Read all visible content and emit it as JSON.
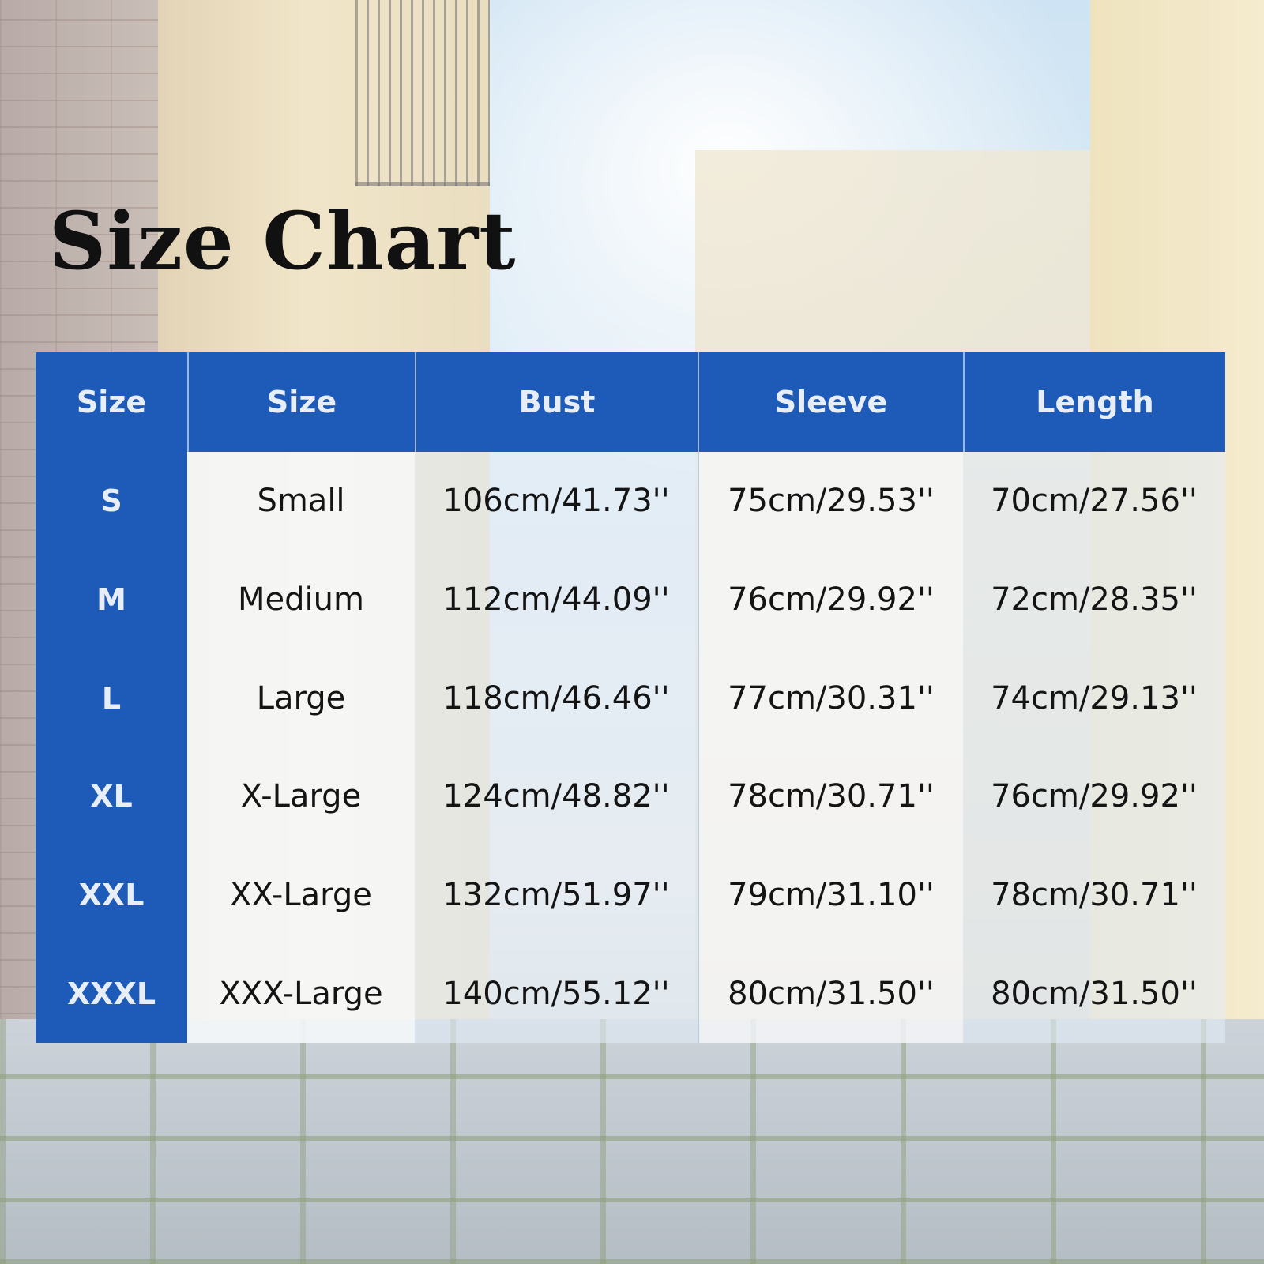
{
  "title": "Size Chart",
  "colors": {
    "header_blue": "#1e5ab7",
    "header_text": "#e8eef8",
    "title_text": "#111111"
  },
  "table": {
    "headers": [
      "Size",
      "Size",
      "Bust",
      "Sleeve",
      "Length"
    ],
    "rows": [
      {
        "code": "S",
        "name": "Small",
        "bust": "106cm/41.73''",
        "sleeve": "75cm/29.53''",
        "length": "70cm/27.56''"
      },
      {
        "code": "M",
        "name": "Medium",
        "bust": "112cm/44.09''",
        "sleeve": "76cm/29.92''",
        "length": "72cm/28.35''"
      },
      {
        "code": "L",
        "name": "Large",
        "bust": "118cm/46.46''",
        "sleeve": "77cm/30.31''",
        "length": "74cm/29.13''"
      },
      {
        "code": "XL",
        "name": "X-Large",
        "bust": "124cm/48.82''",
        "sleeve": "78cm/30.71''",
        "length": "76cm/29.92''"
      },
      {
        "code": "XXL",
        "name": "XX-Large",
        "bust": "132cm/51.97''",
        "sleeve": "79cm/31.10''",
        "length": "78cm/30.71''"
      },
      {
        "code": "XXXL",
        "name": "XXX-Large",
        "bust": "140cm/55.12''",
        "sleeve": "80cm/31.50''",
        "length": "80cm/31.50''"
      }
    ]
  }
}
